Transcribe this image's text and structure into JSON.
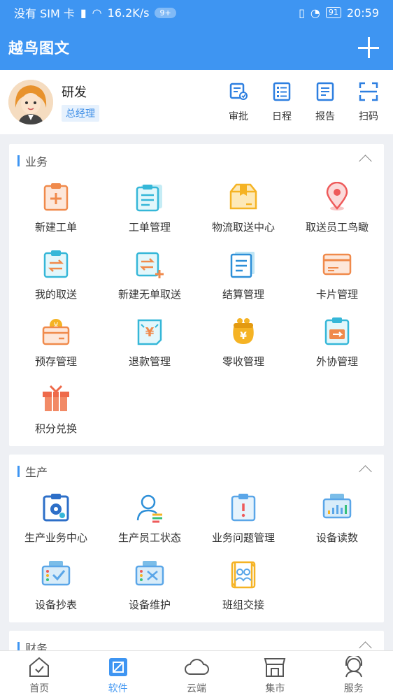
{
  "status_bar": {
    "carrier": "没有 SIM 卡",
    "speed": "16.2K/s",
    "badge": "9+",
    "battery": "91",
    "time": "20:59"
  },
  "header": {
    "title": "越鸟图文"
  },
  "profile": {
    "name": "研发",
    "role": "总经理",
    "actions": [
      {
        "label": "审批",
        "icon": "approval-icon"
      },
      {
        "label": "日程",
        "icon": "schedule-icon"
      },
      {
        "label": "报告",
        "icon": "report-icon"
      },
      {
        "label": "扫码",
        "icon": "scan-icon"
      }
    ]
  },
  "sections": [
    {
      "title": "业务",
      "items": [
        {
          "label": "新建工单",
          "icon": "new-ticket-icon"
        },
        {
          "label": "工单管理",
          "icon": "ticket-manage-icon"
        },
        {
          "label": "物流取送中心",
          "icon": "logistics-box-icon"
        },
        {
          "label": "取送员工鸟瞰",
          "icon": "location-pin-icon"
        },
        {
          "label": "我的取送",
          "icon": "my-delivery-icon"
        },
        {
          "label": "新建无单取送",
          "icon": "new-delivery-icon"
        },
        {
          "label": "结算管理",
          "icon": "settlement-icon"
        },
        {
          "label": "卡片管理",
          "icon": "card-icon"
        },
        {
          "label": "预存管理",
          "icon": "prepaid-icon"
        },
        {
          "label": "退款管理",
          "icon": "refund-icon"
        },
        {
          "label": "零收管理",
          "icon": "purse-icon"
        },
        {
          "label": "外协管理",
          "icon": "outsource-icon"
        },
        {
          "label": "积分兑换",
          "icon": "gift-icon"
        }
      ]
    },
    {
      "title": "生产",
      "items": [
        {
          "label": "生产业务中心",
          "icon": "production-gear-icon"
        },
        {
          "label": "生产员工状态",
          "icon": "staff-status-icon"
        },
        {
          "label": "业务问题管理",
          "icon": "issue-icon"
        },
        {
          "label": "设备读数",
          "icon": "device-reading-icon"
        },
        {
          "label": "设备抄表",
          "icon": "device-meter-icon"
        },
        {
          "label": "设备维护",
          "icon": "device-maintain-icon"
        },
        {
          "label": "班组交接",
          "icon": "team-handover-icon"
        }
      ]
    },
    {
      "title": "财务",
      "items": []
    }
  ],
  "bottom_nav": [
    {
      "label": "首页",
      "icon": "home-icon",
      "active": false
    },
    {
      "label": "软件",
      "icon": "software-icon",
      "active": true
    },
    {
      "label": "云端",
      "icon": "cloud-icon",
      "active": false
    },
    {
      "label": "集市",
      "icon": "market-icon",
      "active": false
    },
    {
      "label": "服务",
      "icon": "service-icon",
      "active": false
    }
  ],
  "colors": {
    "primary": "#3e95f2",
    "orange": "#f08a4b",
    "teal": "#35b7d8",
    "yellow": "#f5b324",
    "red": "#ee5a5a"
  }
}
